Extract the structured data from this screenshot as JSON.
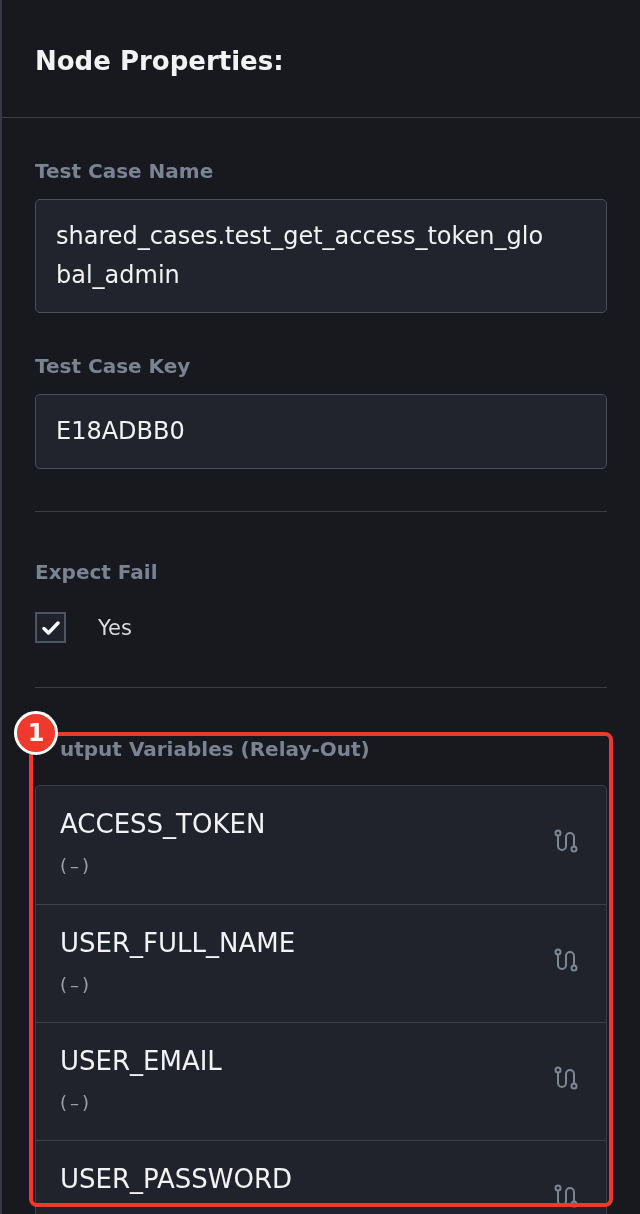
{
  "panel": {
    "title": "Node Properties:"
  },
  "fields": [
    {
      "label": "Test Case Name",
      "value": "shared_cases.test_get_access_token_global_admin"
    },
    {
      "label": "Test Case Key",
      "value": "E18ADBB0"
    }
  ],
  "expect_fail": {
    "label": "Expect Fail",
    "option": "Yes",
    "checked": true
  },
  "output_variables": {
    "label": "utput Variables (Relay-Out)",
    "items": [
      {
        "name": "ACCESS_TOKEN",
        "value": "(–)"
      },
      {
        "name": "USER_FULL_NAME",
        "value": "(–)"
      },
      {
        "name": "USER_EMAIL",
        "value": "(–)"
      },
      {
        "name": "USER_PASSWORD"
      }
    ]
  },
  "annotation": {
    "number": "1"
  }
}
